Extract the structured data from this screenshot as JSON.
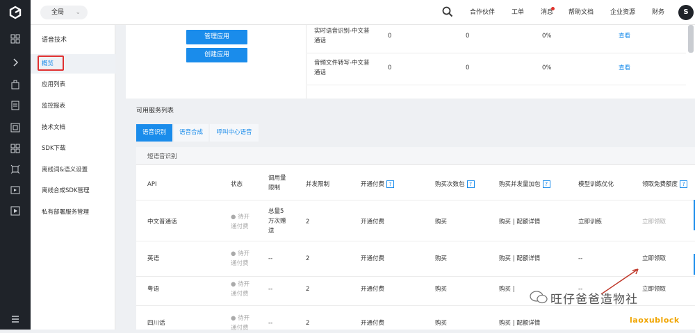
{
  "header": {
    "region": "全局",
    "nav": [
      "合作伙伴",
      "工单",
      "消息",
      "帮助文档",
      "企业资源",
      "财务"
    ],
    "avatar": "S"
  },
  "rail_icons": [
    "apps-icon",
    "expand-icon",
    "module-icon",
    "doc-icon",
    "box-icon",
    "grid-icon",
    "network-icon",
    "media-icon",
    "play-icon",
    "menu-icon"
  ],
  "sidebar": {
    "title": "语音技术",
    "items": [
      {
        "label": "概览"
      },
      {
        "label": "应用列表"
      },
      {
        "label": "监控报表"
      },
      {
        "label": "技术文档"
      },
      {
        "label": "SDK下载"
      },
      {
        "label": "离线词&语义设置"
      },
      {
        "label": "离线合成SDK管理"
      },
      {
        "label": "私有部署服务管理"
      }
    ]
  },
  "overview": {
    "buttons": {
      "manage": "管理应用",
      "create": "创建应用"
    },
    "rows": [
      {
        "name_l1": "实时语音识别-中文普",
        "name_l2": "通话",
        "v1": "0",
        "v2": "0",
        "pct": "0%",
        "action": "查看"
      },
      {
        "name_l1": "音频文件转写-中文普",
        "name_l2": "通话",
        "v1": "0",
        "v2": "0",
        "pct": "0%",
        "action": "查看"
      }
    ]
  },
  "services": {
    "title": "可用服务列表",
    "tabs": [
      "语音识别",
      "语音合成",
      "呼叫中心语音"
    ],
    "section": "短语音识别",
    "columns": {
      "api": "API",
      "status": "状态",
      "quota_l1": "调用量",
      "quota_l2": "限制",
      "concurrency": "并发限制",
      "open_pay": "开通付费",
      "buy_count": "购买次数包",
      "buy_conc": "购买并发量加包",
      "model": "模型训练优化",
      "free": "领取免费额度",
      "help": "?"
    },
    "rows": [
      {
        "api": "中文普通话",
        "status_l1": "● 待开",
        "status_l2": "通付费",
        "quota_l1": "总量5",
        "quota_l2": "万次赠",
        "quota_l3": "送",
        "conc": "2",
        "open": "开通付费",
        "buy": "购买",
        "buyc": "购买 | 配额详情",
        "model": "立即训练",
        "free": "立即领取"
      },
      {
        "api": "英语",
        "status_l1": "● 待开",
        "status_l2": "通付费",
        "quota_l1": "--",
        "conc": "2",
        "open": "开通付费",
        "buy": "购买",
        "buyc": "购买 | 配额详情",
        "model": "--",
        "free": "立即领取"
      },
      {
        "api": "粤语",
        "status_l1": "● 待开",
        "status_l2": "通付费",
        "quota_l1": "--",
        "conc": "2",
        "open": "开通付费",
        "buy": "购买",
        "buyc": "购买 |",
        "model": "--",
        "free": "立即领取"
      },
      {
        "api": "四川话",
        "status_l1": "● 待开",
        "status_l2": "通付费",
        "quota_l1": "--",
        "conc": "2",
        "open": "开通付费",
        "buy": "购买",
        "buyc": "购买 | 配额详情",
        "model": "",
        "free": ""
      }
    ]
  },
  "watermark": {
    "text": "旺仔爸爸造物社",
    "site": "laoxublock"
  },
  "colors": {
    "accent": "#1a8ceb",
    "dark": "#1f2329",
    "highlight": "#e03030",
    "arrow": "#c0392b"
  }
}
